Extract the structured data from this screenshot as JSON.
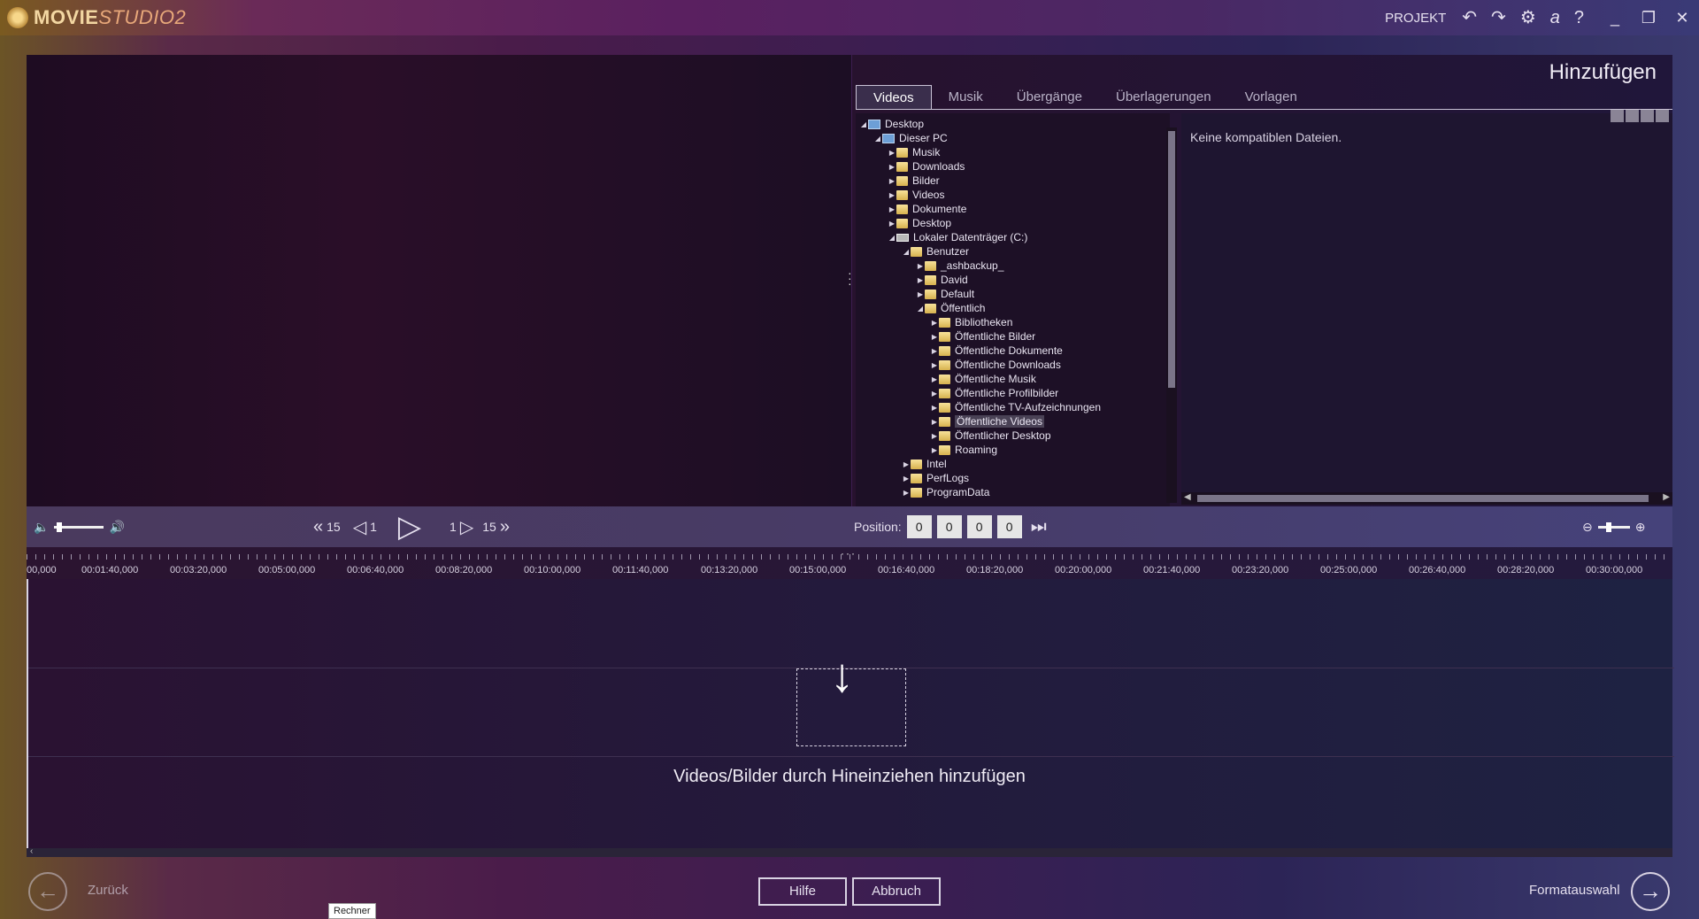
{
  "app": {
    "name_part1": "MOVIE",
    "name_part2": "STUDIO",
    "name_part3": "2"
  },
  "titlebar": {
    "project_label": "PROJEKT",
    "icons": [
      "undo-icon",
      "redo-icon",
      "gear-icon",
      "amazon-icon",
      "help-icon",
      "minimize-icon",
      "restore-icon",
      "close-icon"
    ]
  },
  "add_panel": {
    "title": "Hinzufügen",
    "tabs": [
      "Videos",
      "Musik",
      "Übergänge",
      "Überlagerungen",
      "Vorlagen"
    ],
    "active_tab": "Videos",
    "no_files_message": "Keine kompatiblen Dateien."
  },
  "tree": [
    {
      "label": "Desktop"
    },
    {
      "label": "Dieser PC"
    },
    {
      "label": "Musik"
    },
    {
      "label": "Downloads"
    },
    {
      "label": "Bilder"
    },
    {
      "label": "Videos"
    },
    {
      "label": "Dokumente"
    },
    {
      "label": "Desktop"
    },
    {
      "label": "Lokaler Datenträger (C:)"
    },
    {
      "label": "Benutzer"
    },
    {
      "label": "_ashbackup_"
    },
    {
      "label": "David"
    },
    {
      "label": "Default"
    },
    {
      "label": "Öffentlich"
    },
    {
      "label": "Bibliotheken"
    },
    {
      "label": "Öffentliche Bilder"
    },
    {
      "label": "Öffentliche Dokumente"
    },
    {
      "label": "Öffentliche Downloads"
    },
    {
      "label": "Öffentliche Musik"
    },
    {
      "label": "Öffentliche Profilbilder"
    },
    {
      "label": "Öffentliche TV-Aufzeichnungen"
    },
    {
      "label": "Öffentliche Videos",
      "selected": true
    },
    {
      "label": "Öffentlicher Desktop"
    },
    {
      "label": "Roaming"
    },
    {
      "label": "Intel"
    },
    {
      "label": "PerfLogs"
    },
    {
      "label": "ProgramData"
    }
  ],
  "transport": {
    "rewind_step": "15",
    "frame_back_step": "1",
    "frame_fwd_step": "1",
    "fwd_step": "15",
    "position_label": "Position:",
    "position": [
      "0",
      "0",
      "0",
      "0"
    ],
    "volume_level": 0.05,
    "zoom_level": 0.3
  },
  "ruler": [
    "00,000",
    "00:01:40,000",
    "00:03:20,000",
    "00:05:00,000",
    "00:06:40,000",
    "00:08:20,000",
    "00:10:00,000",
    "00:11:40,000",
    "00:13:20,000",
    "00:15:00,000",
    "00:16:40,000",
    "00:18:20,000",
    "00:20:00,000",
    "00:21:40,000",
    "00:23:20,000",
    "00:25:00,000",
    "00:26:40,000",
    "00:28:20,000",
    "00:30:00,000"
  ],
  "timeline": {
    "drop_hint": "Videos/Bilder durch Hineinziehen hinzufügen"
  },
  "bottom": {
    "back_label": "Zurück",
    "help_label": "Hilfe",
    "cancel_label": "Abbruch",
    "next_label": "Formatauswahl",
    "tooltip": "Rechner"
  }
}
